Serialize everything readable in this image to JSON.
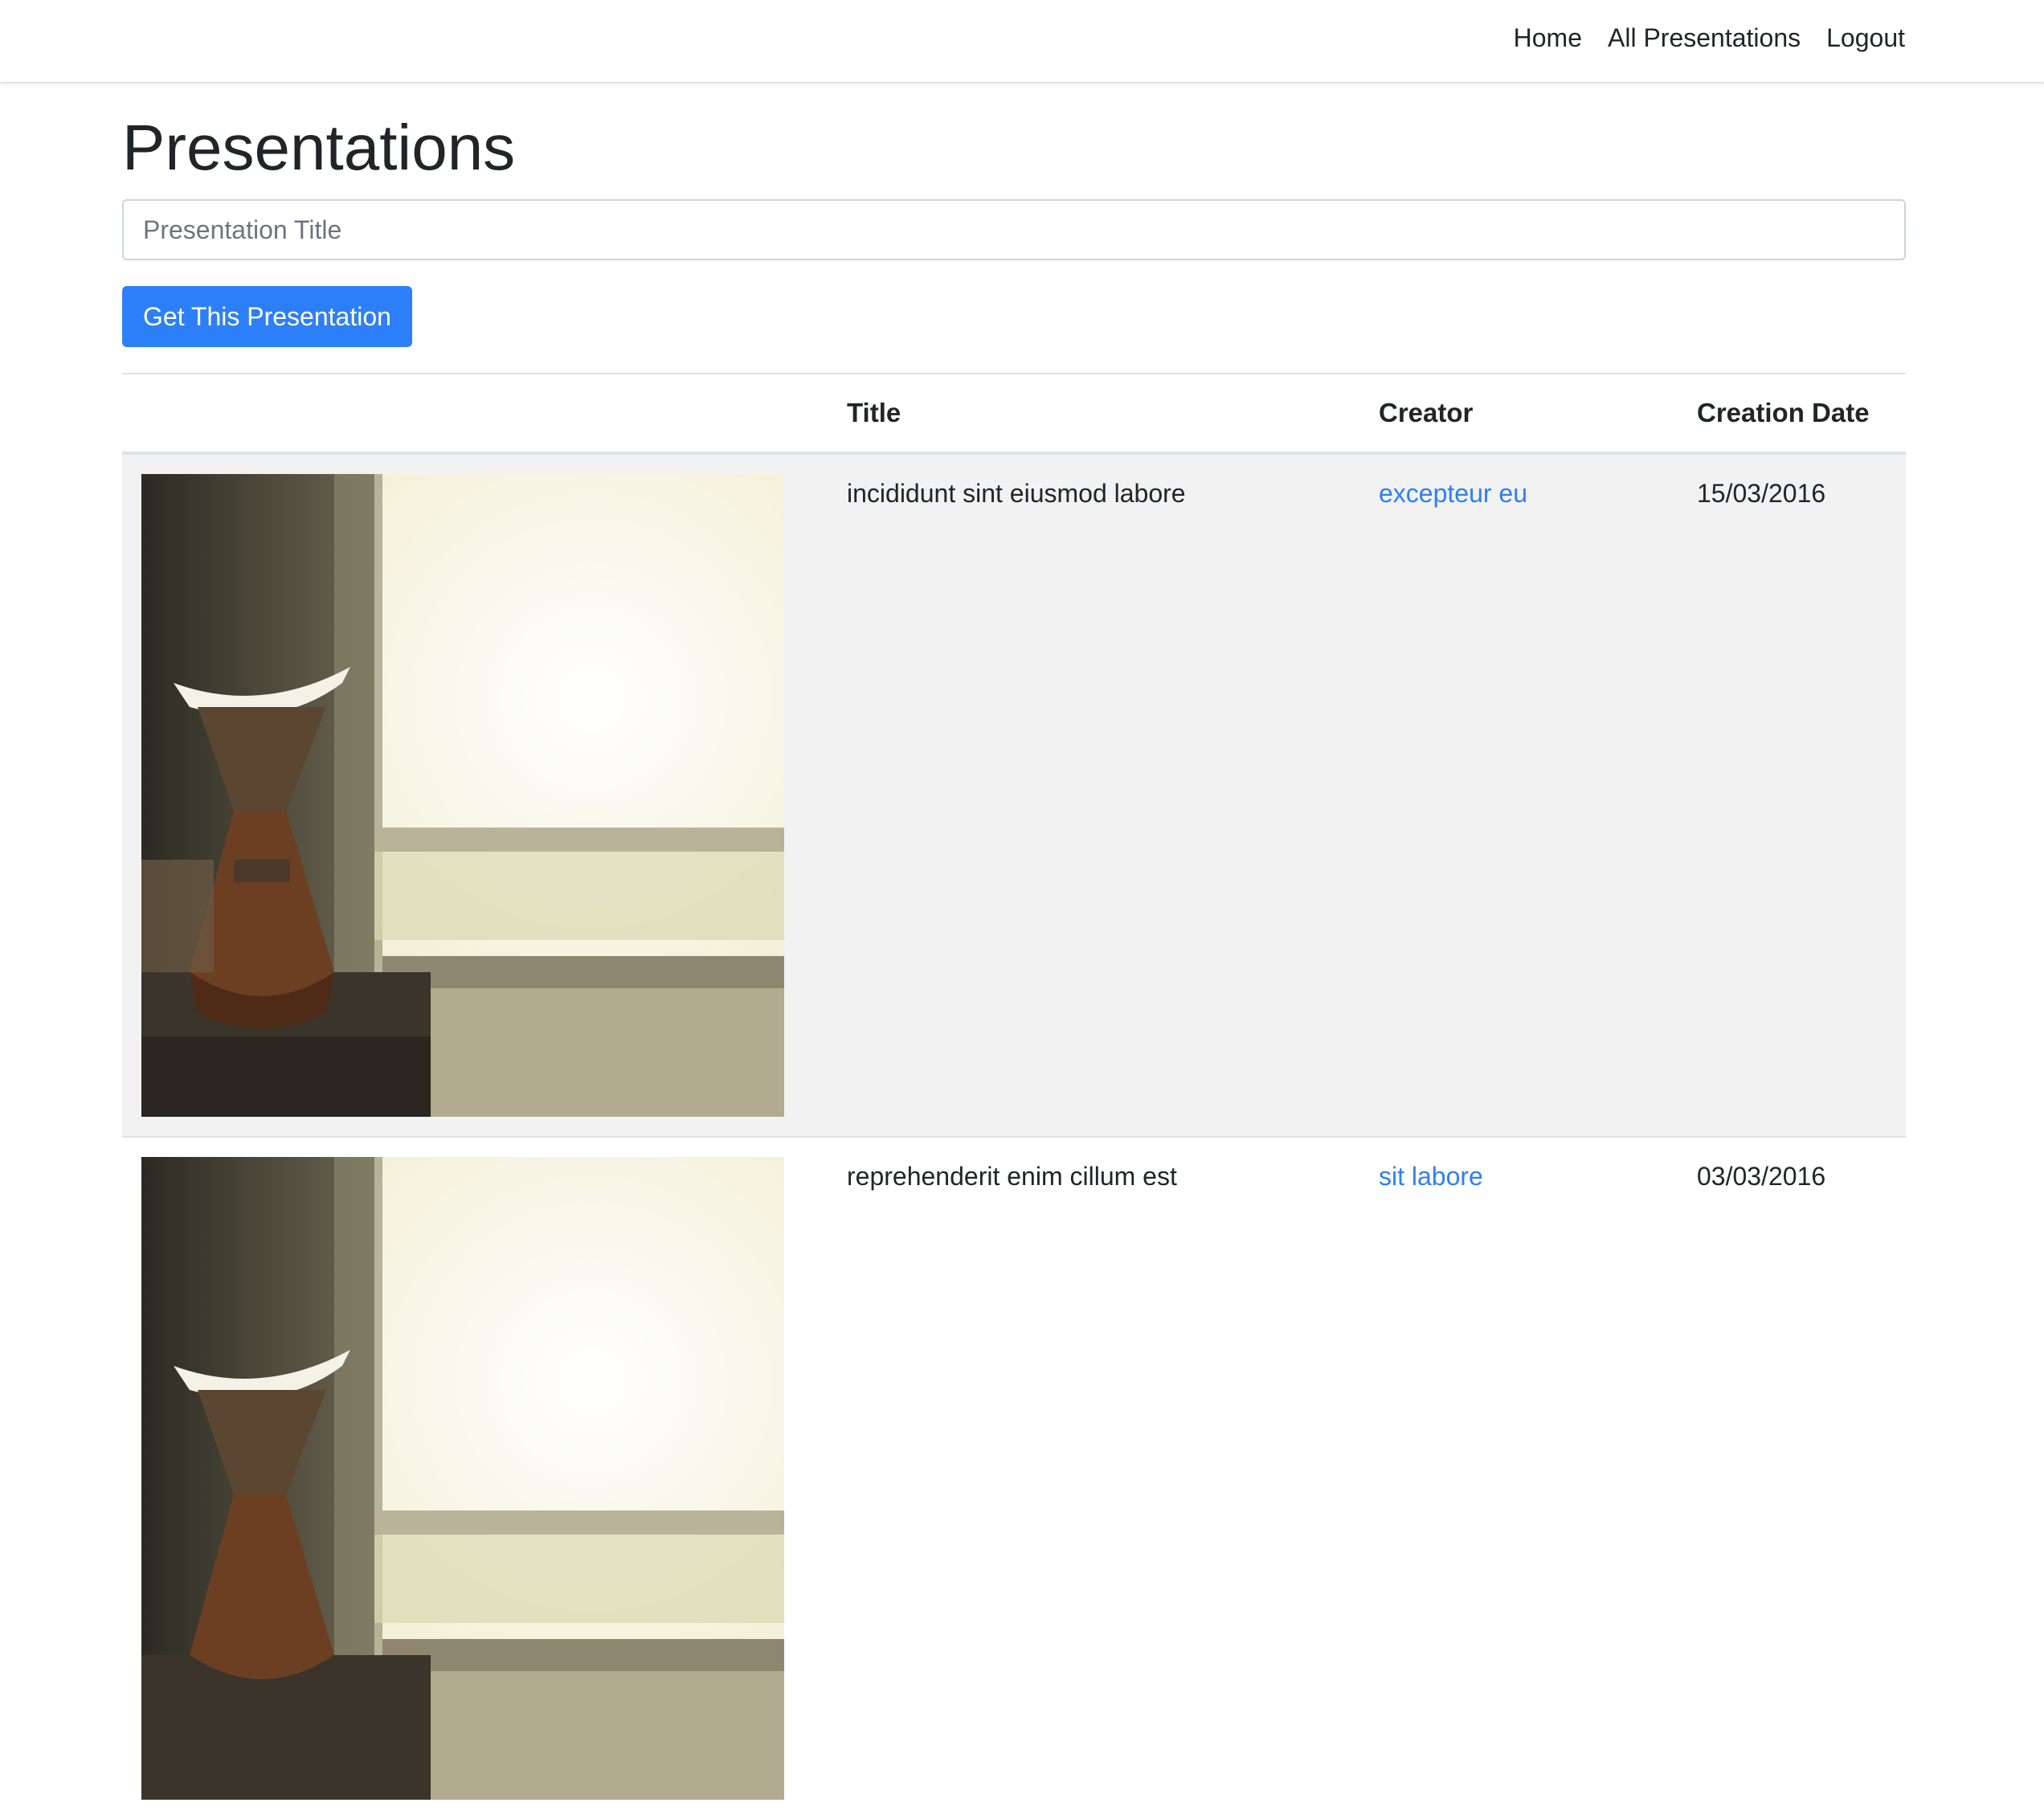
{
  "nav": {
    "links": [
      "Home",
      "All Presentations",
      "Logout"
    ]
  },
  "page": {
    "title": "Presentations"
  },
  "search": {
    "placeholder": "Presentation Title",
    "value": ""
  },
  "actions": {
    "get_button_label": "Get This Presentation"
  },
  "table": {
    "headers": [
      "",
      "Title",
      "Creator",
      "Creation Date"
    ],
    "rows": [
      {
        "image": "coffee-chemex-photo",
        "title": "incididunt sint eiusmod labore",
        "creator": "excepteur eu",
        "date": "15/03/2016"
      },
      {
        "image": "coffee-chemex-photo",
        "title": "reprehenderit enim cillum est",
        "creator": "sit labore",
        "date": "03/03/2016"
      }
    ]
  },
  "colors": {
    "primary": "#2d7ff9",
    "stripe": "#f2f2f2",
    "text": "#212529"
  }
}
